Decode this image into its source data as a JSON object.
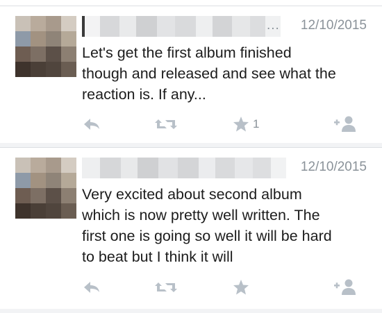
{
  "colors": {
    "meta_gray": "#8a9299",
    "icon_gray": "#b8c0c8",
    "text": "#1c1c1c",
    "divider": "#dcdfe2"
  },
  "tweets": [
    {
      "name_redacted": true,
      "ellipsis": "...",
      "timestamp": "12/10/2015",
      "lines": [
        "Let's get the first album finished",
        "though and released and see what the",
        "reaction is. If any..."
      ],
      "actions": {
        "reply_icon": "reply-icon",
        "retweet_icon": "retweet-icon",
        "favorite_icon": "star-icon",
        "favorite_count": "1",
        "follow_icon": "follow-icon"
      }
    },
    {
      "name_redacted": true,
      "timestamp": "12/10/2015",
      "lines": [
        "Very excited about second album",
        "which is now pretty well written. The",
        "first one is going so well it will be hard",
        "to beat but I think it will"
      ],
      "actions": {
        "reply_icon": "reply-icon",
        "retweet_icon": "retweet-icon",
        "favorite_icon": "star-icon",
        "follow_icon": "follow-icon"
      }
    }
  ]
}
